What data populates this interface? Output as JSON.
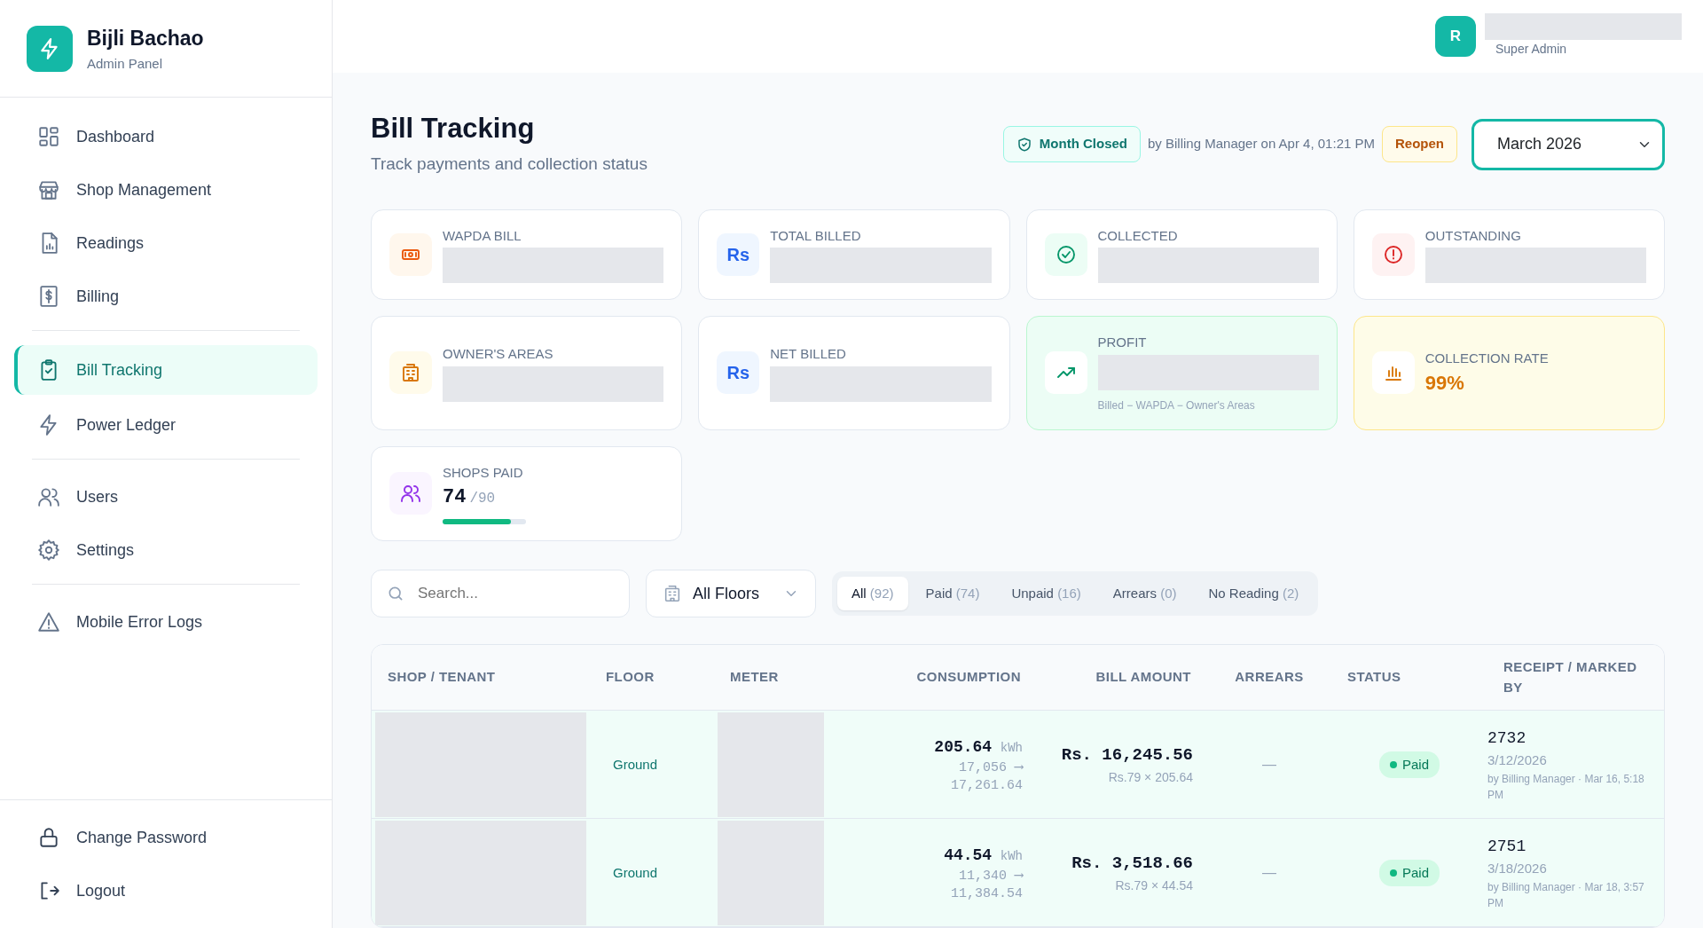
{
  "sidebar": {
    "brand": {
      "title": "Bijli Bachao",
      "subtitle": "Admin Panel"
    },
    "groups": [
      [
        {
          "label": "Dashboard",
          "selected": false
        },
        {
          "label": "Shop Management",
          "selected": false
        },
        {
          "label": "Readings",
          "selected": false
        },
        {
          "label": "Billing",
          "selected": false
        }
      ],
      [
        {
          "label": "Bill Tracking",
          "selected": true
        },
        {
          "label": "Power Ledger",
          "selected": false
        }
      ],
      [
        {
          "label": "Users",
          "selected": false
        },
        {
          "label": "Settings",
          "selected": false
        }
      ],
      [
        {
          "label": "Mobile Error Logs",
          "selected": false
        }
      ]
    ],
    "footer": [
      {
        "label": "Change Password"
      },
      {
        "label": "Logout"
      }
    ]
  },
  "topbar": {
    "avatar": "R",
    "role": "Super Admin"
  },
  "page": {
    "title": "Bill Tracking",
    "subtitle": "Track payments and collection status",
    "month_status": "Month Closed",
    "closed_by": "by Billing Manager on Apr 4, 01:21 PM",
    "reopen": "Reopen",
    "month": "March 2026"
  },
  "cards": [
    {
      "kind": "hidden",
      "label": "WAPDA BILL"
    },
    {
      "kind": "hidden",
      "label": "TOTAL BILLED",
      "icon_text": "Rs"
    },
    {
      "kind": "hidden",
      "label": "COLLECTED"
    },
    {
      "kind": "hidden",
      "label": "OUTSTANDING"
    },
    {
      "kind": "hidden",
      "label": "OWNER'S AREAS"
    },
    {
      "kind": "hidden",
      "label": "NET BILLED",
      "icon_text": "Rs"
    },
    {
      "kind": "hidden",
      "label": "PROFIT",
      "note": "Billed − WAPDA − Owner's Areas"
    },
    {
      "kind": "value",
      "label": "COLLECTION RATE",
      "value": "99%"
    },
    {
      "kind": "progress",
      "label": "SHOPS PAID",
      "value": "74",
      "total": "/90",
      "level": 0.82
    }
  ],
  "filters": {
    "search": {
      "placeholder": "Search..."
    },
    "floor": "All Floors",
    "tabs": [
      {
        "label": "All",
        "count": "(92)",
        "selected": true
      },
      {
        "label": "Paid",
        "count": "(74)",
        "selected": false
      },
      {
        "label": "Unpaid",
        "count": "(16)",
        "selected": false
      },
      {
        "label": "Arrears",
        "count": "(0)",
        "selected": false
      },
      {
        "label": "No Reading",
        "count": "(2)",
        "selected": false
      }
    ]
  },
  "table": {
    "columns": [
      "SHOP / TENANT",
      "FLOOR",
      "METER",
      "CONSUMPTION",
      "BILL AMOUNT",
      "ARREARS",
      "STATUS",
      "RECEIPT / MARKED BY"
    ],
    "rows": [
      {
        "floor": "Ground",
        "kwh": "205.64",
        "unit": "kWh",
        "from": "17,056 ⟶",
        "to": "17,261.64",
        "bill": "Rs. 16,245.56",
        "rate": "Rs.79 × 205.64",
        "arrears": "—",
        "status": "Paid",
        "paid": true,
        "receipt": "2732",
        "date": "3/12/2026",
        "marked_by": "by Billing Manager · Mar 16, 5:18 PM"
      },
      {
        "floor": "Ground",
        "kwh": "44.54",
        "unit": "kWh",
        "from": "11,340 ⟶",
        "to": "11,384.54",
        "bill": "Rs. 3,518.66",
        "rate": "Rs.79 × 44.54",
        "arrears": "—",
        "status": "Paid",
        "paid": true,
        "receipt": "2751",
        "date": "3/18/2026",
        "marked_by": "by Billing Manager · Mar 18, 3:57 PM"
      }
    ]
  }
}
